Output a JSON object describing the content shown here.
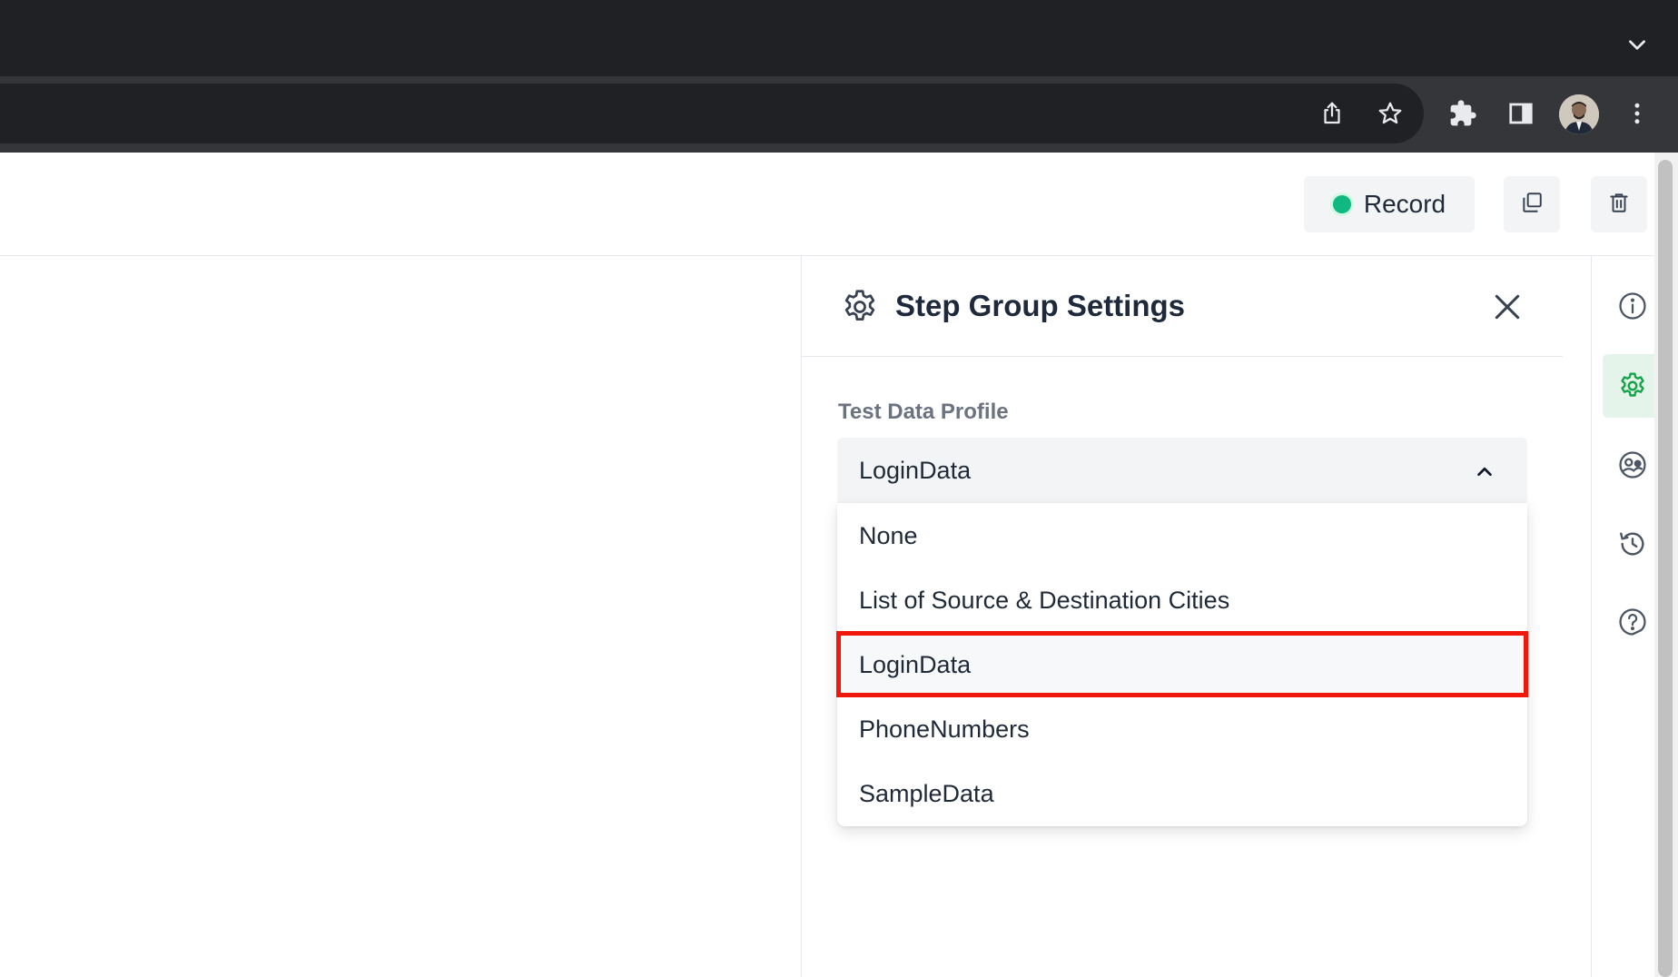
{
  "browser": {
    "icons": [
      "chevron-down-icon",
      "share-icon",
      "star-icon",
      "extensions-icon",
      "side-panel-icon",
      "avatar",
      "more-vert-icon"
    ]
  },
  "header": {
    "record_label": "Record",
    "record_color": "#10b981"
  },
  "panel": {
    "title": "Step Group Settings",
    "field_label": "Test Data Profile",
    "selected_value": "LoginData",
    "options": [
      "None",
      "List of Source & Destination Cities",
      "LoginData",
      "PhoneNumbers",
      "SampleData"
    ],
    "highlight_color": "#f1170a"
  },
  "rail": {
    "icons": [
      "info-icon",
      "gear-icon",
      "users-icon",
      "history-icon",
      "help-icon"
    ],
    "active": "gear-icon",
    "active_color": "#16a34a"
  }
}
